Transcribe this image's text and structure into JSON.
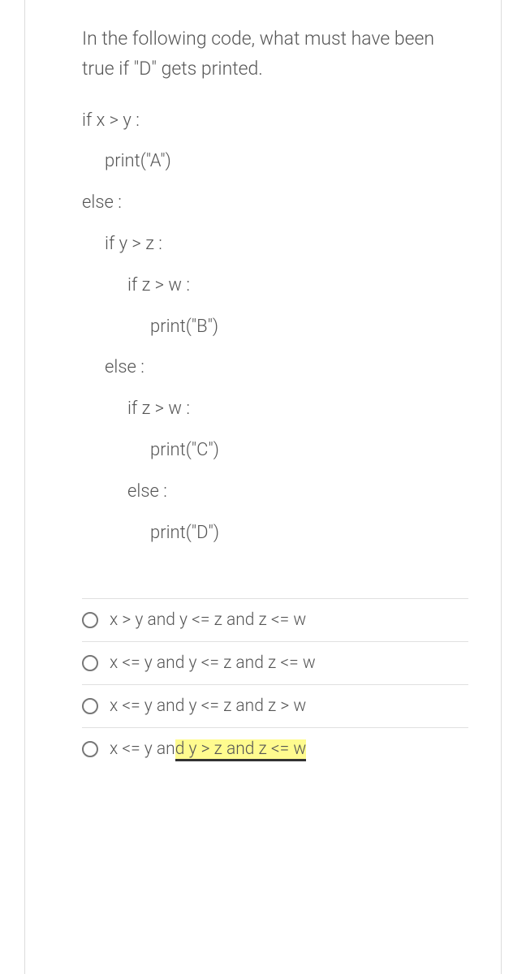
{
  "question": "In the following code, what must have been true if \"D\" gets printed.",
  "code": {
    "line1": "if x > y :",
    "line2": "print(\"A\")",
    "line3": "else :",
    "line4": "if y > z :",
    "line5": "if z > w :",
    "line6": "print(\"B\")",
    "line7": "else :",
    "line8": "if z > w :",
    "line9": "print(\"C\")",
    "line10": "else :",
    "line11": "print(\"D\")"
  },
  "options": {
    "a": "x > y and y <= z and z <= w",
    "b": "x <= y and y <= z and z <= w",
    "c": "x <= y and y <= z and z > w",
    "d_part1": "x <= y an",
    "d_part2": "d y > z and z <= w"
  }
}
